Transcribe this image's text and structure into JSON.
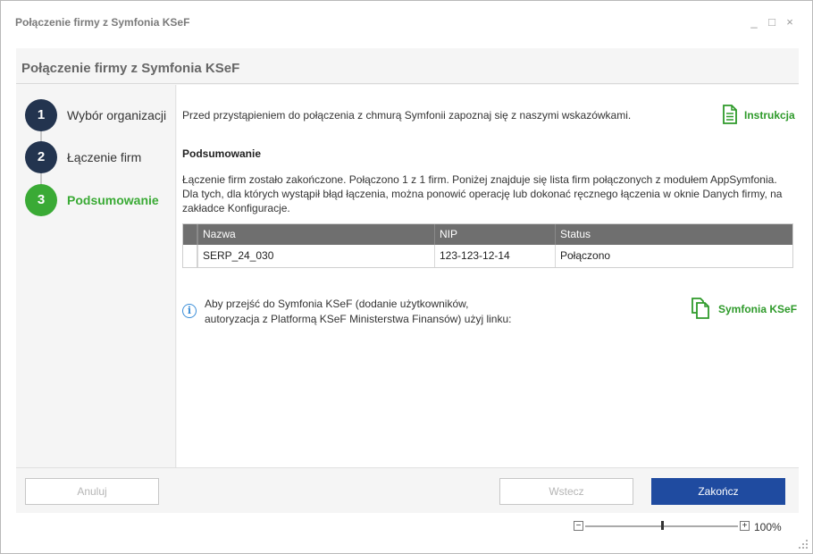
{
  "window": {
    "title": "Połączenie firmy z Symfonia KSeF",
    "controls": {
      "minimize": "_",
      "maximize": "□",
      "close": "×"
    }
  },
  "header": {
    "title": "Połączenie firmy z Symfonia KSeF"
  },
  "steps": [
    {
      "number": "1",
      "label": "Wybór organizacji",
      "state": "done"
    },
    {
      "number": "2",
      "label": "Łączenie firm",
      "state": "done"
    },
    {
      "number": "3",
      "label": "Podsumowanie",
      "state": "active"
    }
  ],
  "main": {
    "intro": "Przed przystąpieniem do połączenia z chmurą Symfonii zapoznaj się z naszymi wskazówkami.",
    "instruction_link": "Instrukcja",
    "summary_title": "Podsumowanie",
    "summary_text": "Łączenie firm zostało zakończone. Połączono 1 z 1 firm. Poniżej znajduje się lista firm połączonych z modułem AppSymfonia. Dla tych, dla których wystąpił błąd łączenia, można ponowić operację lub dokonać ręcznego łączenia w oknie Danych firmy, na zakładce Konfiguracje.",
    "table": {
      "columns": [
        "Nazwa",
        "NIP",
        "Status"
      ],
      "rows": [
        [
          "SERP_24_030",
          "123-123-12-14",
          "Połączono"
        ]
      ]
    },
    "info_line1": "Aby przejść do Symfonia KSeF (dodanie użytkowników,",
    "info_line2": "autoryzacja z Platformą KSeF Ministerstwa Finansów) użyj linku:",
    "ksef_link": "Symfonia KSeF"
  },
  "footer": {
    "cancel_label": "Anuluj",
    "back_label": "Wstecz",
    "finish_label": "Zakończ"
  },
  "zoom": {
    "minus": "−",
    "plus": "+",
    "level": "100%",
    "value_fraction": 0.5
  },
  "colors": {
    "accent_green": "#3aaa35",
    "step_dark": "#23344f",
    "primary_blue": "#1f4ba0",
    "table_header": "#6f6f6f"
  }
}
